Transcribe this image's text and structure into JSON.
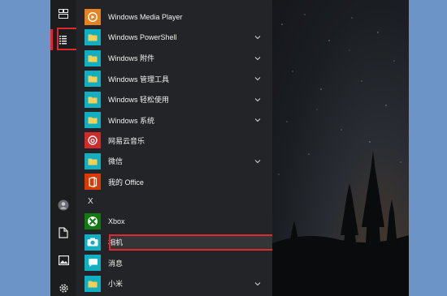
{
  "rail": {
    "icons": [
      "tiles-icon",
      "list-icon",
      "user-icon",
      "document-icon",
      "pictures-icon",
      "settings-icon"
    ]
  },
  "apps": [
    {
      "label": "Windows Media Player",
      "icon": "media-player-icon",
      "color": "#e8821e",
      "expandable": false
    },
    {
      "label": "Windows PowerShell",
      "icon": "folder-icon",
      "color": "#10b0c2",
      "expandable": true
    },
    {
      "label": "Windows 附件",
      "icon": "folder-icon",
      "color": "#10b0c2",
      "expandable": true
    },
    {
      "label": "Windows 管理工具",
      "icon": "folder-icon",
      "color": "#10b0c2",
      "expandable": true
    },
    {
      "label": "Windows 轻松使用",
      "icon": "folder-icon",
      "color": "#10b0c2",
      "expandable": true
    },
    {
      "label": "Windows 系统",
      "icon": "folder-icon",
      "color": "#10b0c2",
      "expandable": true
    },
    {
      "label": "网易云音乐",
      "icon": "netease-music-icon",
      "color": "#d22a2a",
      "expandable": false
    },
    {
      "label": "微信",
      "icon": "folder-icon",
      "color": "#10b0c2",
      "expandable": true
    },
    {
      "label": "我的 Office",
      "icon": "office-icon",
      "color": "#d83b01",
      "expandable": false
    }
  ],
  "section_letter": "X",
  "apps_x": [
    {
      "label": "Xbox",
      "icon": "xbox-icon",
      "color": "#107c10",
      "expandable": false
    },
    {
      "label": "相机",
      "icon": "camera-icon",
      "color": "#10b0c2",
      "expandable": false,
      "selected": true
    },
    {
      "label": "消息",
      "icon": "message-icon",
      "color": "#10b0c2",
      "expandable": false
    },
    {
      "label": "小米",
      "icon": "folder-icon",
      "color": "#10b0c2",
      "expandable": true
    }
  ],
  "colors": {
    "highlight": "#e0292e",
    "tile": "#10b0c2"
  }
}
